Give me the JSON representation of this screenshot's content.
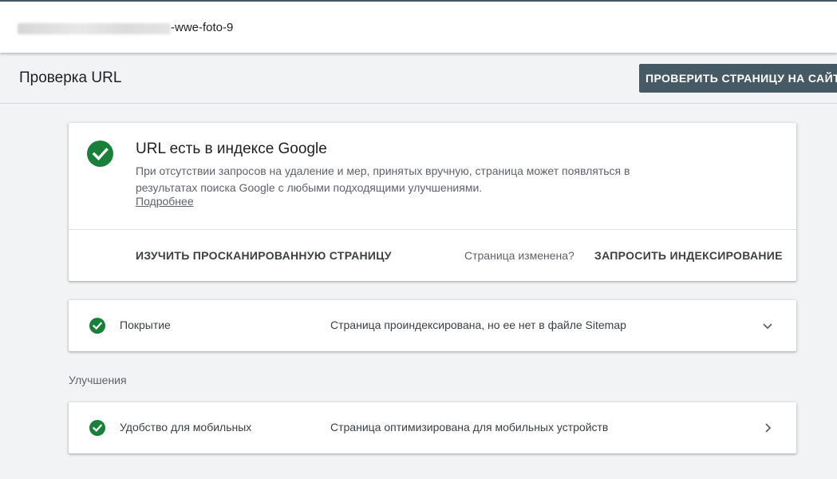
{
  "browser": {
    "url_suffix": "-wwe-foto-9"
  },
  "header": {
    "title": "Проверка URL",
    "test_live_label": "ПРОВЕРИТЬ СТРАНИЦУ НА САЙТЕ"
  },
  "status_card": {
    "title": "URL есть в индексе Google",
    "description": "При отсутствии запросов на удаление и мер, принятых вручную, страница может появляться в результатах поиска Google с любыми подходящими улучшениями.",
    "learn_more": "Подробнее",
    "view_crawled_label": "ИЗУЧИТЬ ПРОСКАНИРОВАННУЮ СТРАНИЦУ",
    "page_changed": "Страница изменена?",
    "request_indexing_label": "ЗАПРОСИТЬ ИНДЕКСИРОВАНИЕ"
  },
  "coverage": {
    "label": "Покрытие",
    "value": "Страница проиндексирована, но ее нет в файле Sitemap",
    "icon": "chevron-down-icon"
  },
  "enhancements": {
    "heading": "Улучшения",
    "items": [
      {
        "label": "Удобство для мобильных",
        "value": "Страница оптимизирована для мобильных устройств",
        "icon": "chevron-right-icon"
      }
    ]
  },
  "colors": {
    "accent": "#455a64",
    "success": "#188038"
  }
}
